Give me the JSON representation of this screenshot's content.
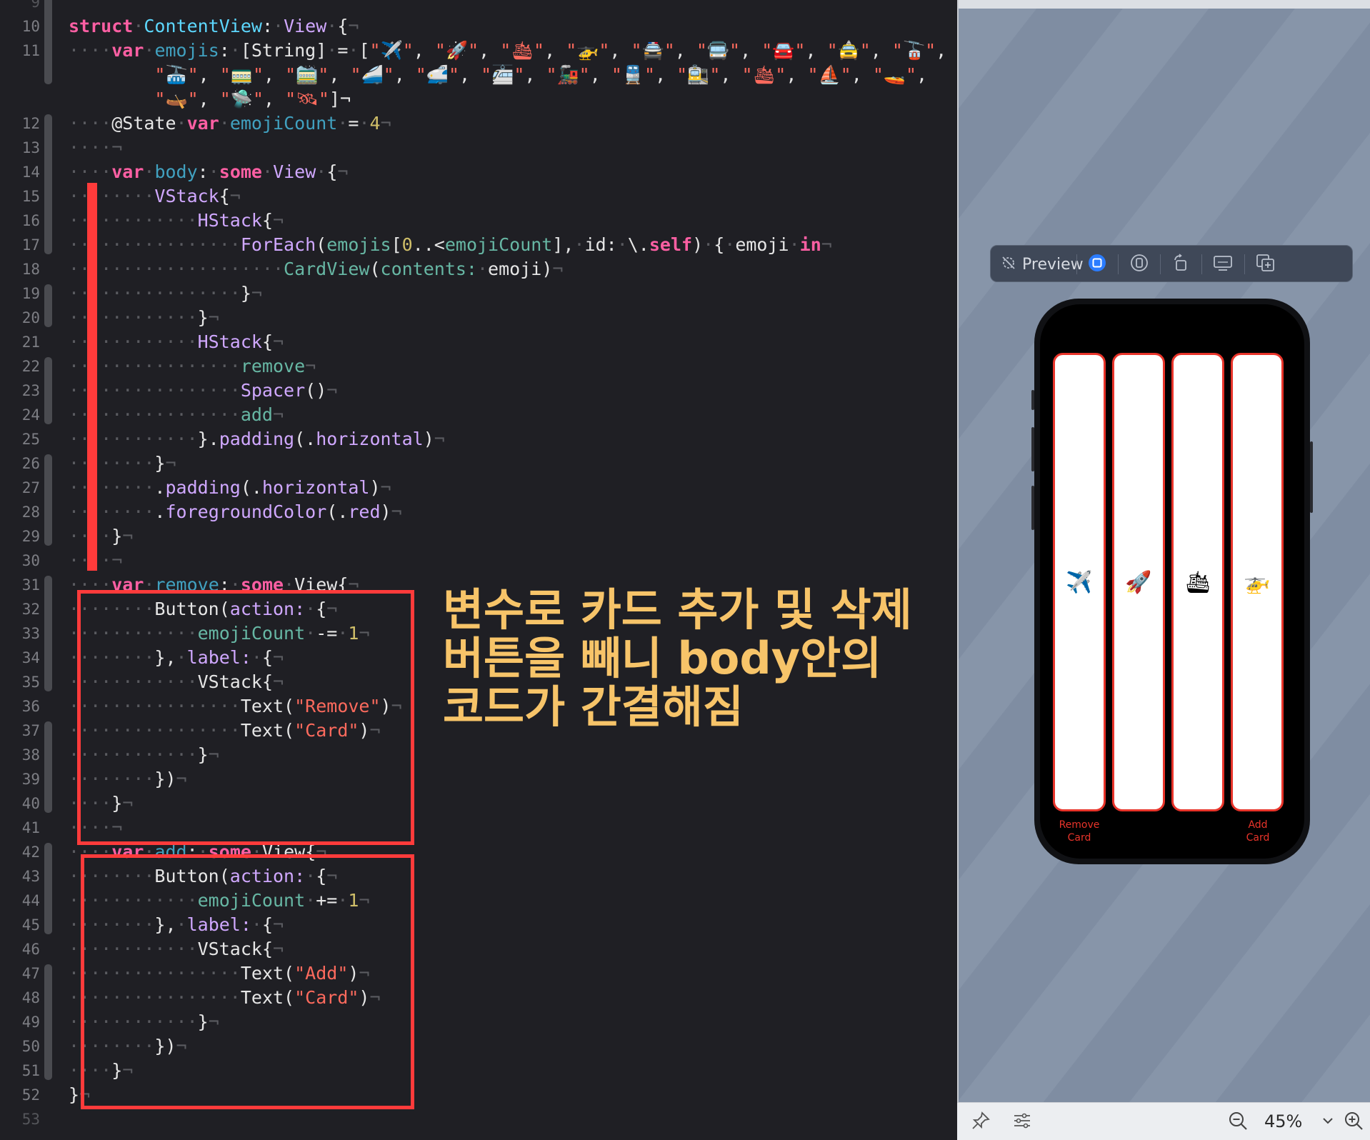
{
  "editor": {
    "line_numbers": [
      "9",
      "10",
      "11",
      "12",
      "13",
      "14",
      "15",
      "16",
      "17",
      "18",
      "19",
      "20",
      "21",
      "22",
      "23",
      "24",
      "25",
      "26",
      "27",
      "28",
      "29",
      "30",
      "31",
      "32",
      "33",
      "34",
      "35",
      "36",
      "37",
      "38",
      "39",
      "40",
      "41",
      "42",
      "43",
      "44",
      "45",
      "46",
      "47",
      "48",
      "49",
      "50",
      "51",
      "52",
      "53"
    ],
    "code": {
      "struct_kw": "struct",
      "struct_name": "ContentView",
      "view_type": "View",
      "var_kw": "var",
      "some_kw": "some",
      "emojis_name": "emojis",
      "string_type": "[String]",
      "emojis_row1": [
        "✈️",
        "🚀",
        "🛳",
        "🚁",
        "🚔",
        "🚍",
        "🚘",
        "🚖",
        "🚡"
      ],
      "emojis_row2": [
        "🚠",
        "🚃",
        "🚞",
        "🚄",
        "🚅",
        "🚈",
        "🚂",
        "🚆",
        "🚉",
        "🛳",
        "⛵️",
        "🚤"
      ],
      "emojis_row3": [
        "🛶",
        "🛸",
        "🛰"
      ],
      "state_attr": "@State",
      "emojicount_name": "emojiCount",
      "emojicount_init": "4",
      "body_name": "body",
      "vstack": "VStack",
      "hstack": "HStack",
      "foreach": "ForEach",
      "foreach_range_start": "0",
      "id_label": "id:",
      "self_kw": "self",
      "emoji_param": "emoji",
      "in_kw": "in",
      "cardview": "CardView",
      "contents_label": "contents:",
      "remove_ref": "remove",
      "spacer": "Spacer",
      "add_ref": "add",
      "padding": "padding",
      "horizontal": "horizontal",
      "foregroundColor": "foregroundColor",
      "red": "red",
      "remove_name": "remove",
      "add_name": "add",
      "button": "Button",
      "action_label": "action:",
      "label_label": "label:",
      "text_type": "Text",
      "minus_op": "-=",
      "plus_op": "+=",
      "step_value": "1",
      "str_remove": "\"Remove\"",
      "str_card": "\"Card\"",
      "str_add": "\"Add\""
    }
  },
  "annotation": {
    "line1": "변수로 카드 추가 및 삭제",
    "line2": "버튼을 빼니 body안의",
    "line3": "코드가 간결해짐",
    "color": "#f7c469"
  },
  "preview": {
    "toolbar_label": "Preview",
    "toolbar_icons": [
      "live-preview-off-icon",
      "live-mode-icon",
      "variants-icon",
      "rotate-device-icon",
      "device-settings-icon",
      "duplicate-preview-icon"
    ],
    "cards": [
      {
        "emoji": "✈️"
      },
      {
        "emoji": "🚀"
      },
      {
        "emoji": "🛳"
      },
      {
        "emoji": "🚁"
      }
    ],
    "remove_button": {
      "line1": "Remove",
      "line2": "Card"
    },
    "add_button": {
      "line1": "Add",
      "line2": "Card"
    },
    "accent_color": "#e8342a",
    "zoom": "45%"
  }
}
